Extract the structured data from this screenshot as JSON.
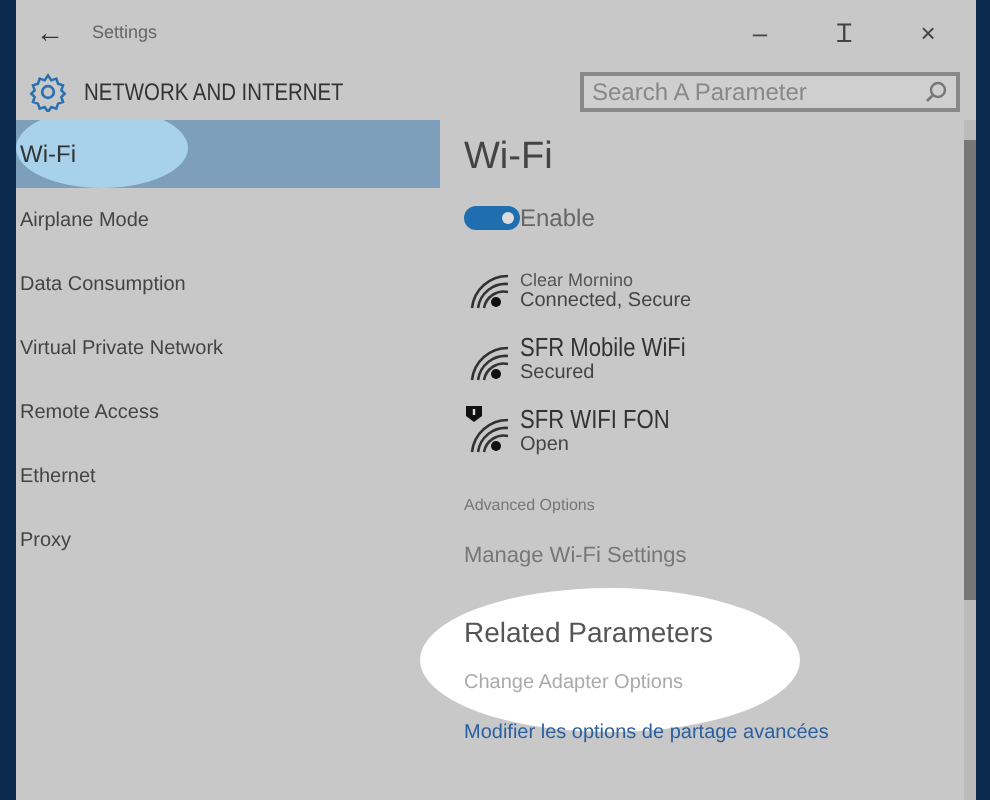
{
  "window": {
    "title": "Settings",
    "back": "←",
    "controls": [
      "–",
      "Ɪ",
      "×"
    ]
  },
  "header": {
    "title": "NETWORK AND INTERNET",
    "search": {
      "placeholder": "Search A Parameter"
    }
  },
  "sidebar": {
    "items": [
      {
        "label": "Wi-Fi",
        "selected": true,
        "highlighted": true
      },
      {
        "label": "Airplane Mode",
        "selected": false,
        "highlighted": false
      },
      {
        "label": "Data Consumption",
        "selected": false,
        "highlighted": false
      },
      {
        "label": "Virtual Private Network",
        "selected": false,
        "highlighted": false
      },
      {
        "label": "Remote Access",
        "selected": false,
        "highlighted": false
      },
      {
        "label": "Ethernet",
        "selected": false,
        "highlighted": false
      },
      {
        "label": "Proxy",
        "selected": false,
        "highlighted": false
      }
    ]
  },
  "content": {
    "title": "Wi-Fi",
    "toggle": {
      "label": "Enable",
      "on": true
    },
    "networks": [
      {
        "name": "Clear Mornino",
        "status": "Connected, Secure",
        "warning": false
      },
      {
        "name": "SFR Mobile WiFi",
        "status": "Secured",
        "warning": false
      },
      {
        "name": "SFR WIFI FON",
        "status": "Open",
        "warning": true
      }
    ],
    "advanced_label": "Advanced Options",
    "manage_link": "Manage Wi-Fi Settings",
    "related_title": "Related Parameters",
    "related_links": [
      "Change Adapter Options",
      "Modifier les options de partage avancées"
    ]
  }
}
